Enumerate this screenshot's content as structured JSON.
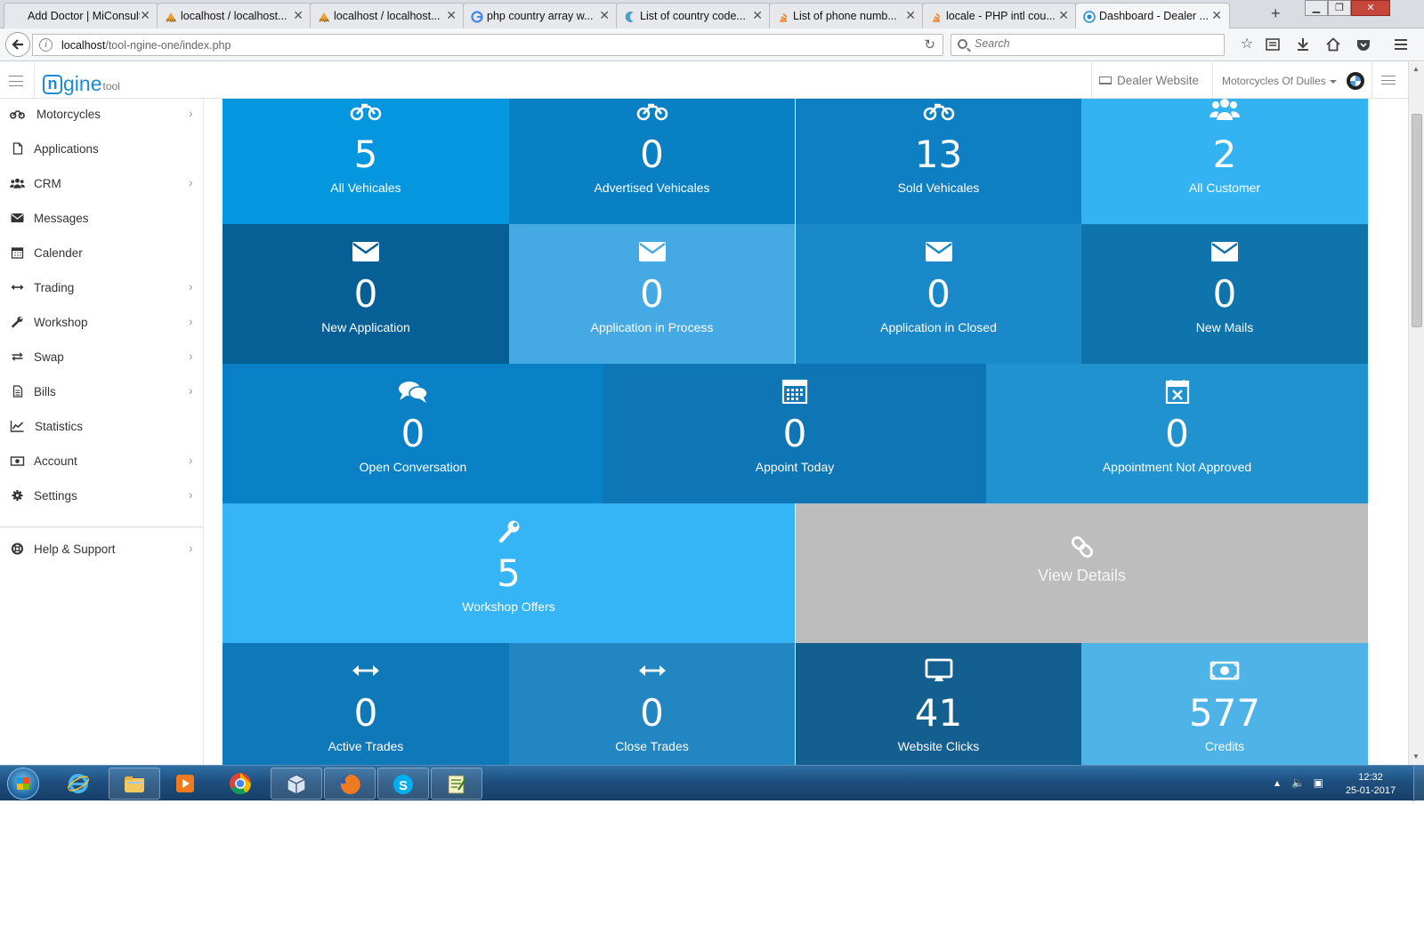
{
  "browser": {
    "tabs": [
      {
        "title": "Add Doctor | MiConsulti..."
      },
      {
        "title": "localhost / localhost..."
      },
      {
        "title": "localhost / localhost..."
      },
      {
        "title": "php country array w..."
      },
      {
        "title": "List of country code..."
      },
      {
        "title": "List of phone numb..."
      },
      {
        "title": "locale - PHP intl cou..."
      },
      {
        "title": "Dashboard - Dealer ..."
      }
    ],
    "active_tab": 7,
    "new_tab_label": "+",
    "url_host": "localhost",
    "url_path": "/tool-ngine-one/index.php",
    "search_placeholder": "Search"
  },
  "app": {
    "logo_mark": "n",
    "logo_text": "gine",
    "logo_suffix": "tool",
    "dealer_website_label": "Dealer Website",
    "dealer_name": "Motorcycles Of Dulles"
  },
  "sidebar": {
    "items": [
      {
        "label": "Motorcycles",
        "icon": "motorcycle-icon",
        "has_submenu": true
      },
      {
        "label": "Applications",
        "icon": "file-icon",
        "has_submenu": false
      },
      {
        "label": "CRM",
        "icon": "users-icon",
        "has_submenu": true
      },
      {
        "label": "Messages",
        "icon": "envelope-icon",
        "has_submenu": false
      },
      {
        "label": "Calender",
        "icon": "calendar-icon",
        "has_submenu": false
      },
      {
        "label": "Trading",
        "icon": "arrows-h-icon",
        "has_submenu": true
      },
      {
        "label": "Workshop",
        "icon": "wrench-icon",
        "has_submenu": true
      },
      {
        "label": "Swap",
        "icon": "exchange-icon",
        "has_submenu": true
      },
      {
        "label": "Bills",
        "icon": "bill-icon",
        "has_submenu": true
      },
      {
        "label": "Statistics",
        "icon": "chart-icon",
        "has_submenu": false
      },
      {
        "label": "Account",
        "icon": "money-icon",
        "has_submenu": true
      },
      {
        "label": "Settings",
        "icon": "gear-icon",
        "has_submenu": true
      },
      {
        "label": "Help & Support",
        "icon": "lifebuoy-icon",
        "has_submenu": true
      }
    ]
  },
  "tiles": {
    "all_vehicales": {
      "value": "5",
      "label": "All Vehicales",
      "icon": "motorcycle-icon",
      "color": "#0497e0"
    },
    "advertised_vehicales": {
      "value": "0",
      "label": "Advertised Vehicales",
      "icon": "motorcycle-icon",
      "color": "#0a80c4"
    },
    "sold_vehicales": {
      "value": "13",
      "label": "Sold Vehicales",
      "icon": "motorcycle-icon",
      "color": "#0d7fc2"
    },
    "all_customer": {
      "value": "2",
      "label": "All Customer",
      "icon": "users-icon",
      "color": "#34b3f3"
    },
    "new_application": {
      "value": "0",
      "label": "New Application",
      "icon": "envelope-icon",
      "color": "#065f95"
    },
    "application_in_process": {
      "value": "0",
      "label": "Application in Process",
      "icon": "envelope-icon",
      "color": "#45aae4"
    },
    "application_in_closed": {
      "value": "0",
      "label": "Application in Closed",
      "icon": "envelope-icon",
      "color": "#1a89c9"
    },
    "new_mails": {
      "value": "0",
      "label": "New Mails",
      "icon": "envelope-icon",
      "color": "#0f73ac"
    },
    "open_conversation": {
      "value": "0",
      "label": "Open Conversation",
      "icon": "comments-icon",
      "color": "#0a81c7"
    },
    "appoint_today": {
      "value": "0",
      "label": "Appoint Today",
      "icon": "calendar-icon",
      "color": "#0e76b4"
    },
    "appointment_not_approved": {
      "value": "0",
      "label": "Appointment Not Approved",
      "icon": "calendar-x-icon",
      "color": "#2192d0"
    },
    "workshop_offers": {
      "value": "5",
      "label": "Workshop Offers",
      "icon": "wrench-icon",
      "color": "#35b5f5"
    },
    "view_details": {
      "label": "View Details",
      "icon": "link-icon",
      "color": "#bdbdbd"
    },
    "active_trades": {
      "value": "0",
      "label": "Active Trades",
      "icon": "arrows-h-icon",
      "color": "#0f78b8"
    },
    "close_trades": {
      "value": "0",
      "label": "Close Trades",
      "icon": "arrows-h-icon",
      "color": "#2286c2"
    },
    "website_clicks": {
      "value": "41",
      "label": "Website Clicks",
      "icon": "desktop-icon",
      "color": "#135f8f"
    },
    "credits": {
      "value": "577",
      "label": "Credits",
      "icon": "money-icon",
      "color": "#4eb3e6"
    }
  },
  "taskbar": {
    "time": "12:32",
    "date": "25-01-2017"
  }
}
